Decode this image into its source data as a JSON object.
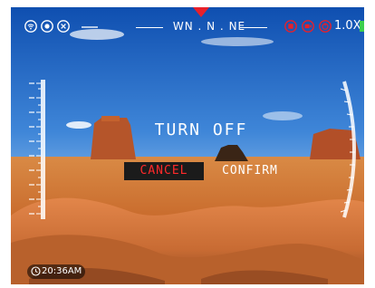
{
  "status_bar": {
    "left_icons": [
      "wifi-icon",
      "photo-mode-icon",
      "settings-icon"
    ],
    "right_icons": [
      "record-icon",
      "video-icon",
      "power-icon"
    ],
    "zoom_level": "1.0X",
    "battery_icon": "battery-icon"
  },
  "compass": {
    "heading_text": "WN . N . NE",
    "marker_color": "#e8202a"
  },
  "dialog": {
    "title": "TURN OFF",
    "cancel_label": "CANCEL",
    "confirm_label": "CONFIRM"
  },
  "clock": {
    "icon": "clock-icon",
    "time": "20:36AM"
  },
  "colors": {
    "accent_red": "#e8202a",
    "cancel_text": "#ff2a2a",
    "text_white": "#ffffff"
  }
}
